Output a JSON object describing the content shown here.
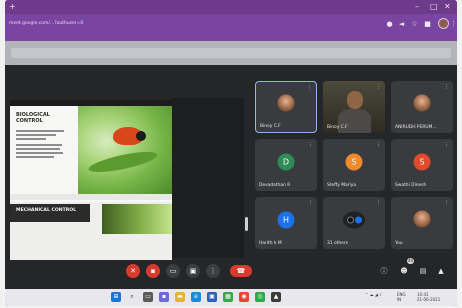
{
  "browser": {
    "url": "meet.google.com/...?authuser=0",
    "profile_icon": "user-avatar"
  },
  "slide": {
    "title": "BIOLOGICAL CONTROL",
    "bottom_title": "MECHANICAL CONTROL"
  },
  "participants": [
    {
      "name": "Binoy C.F",
      "avatar_type": "photo",
      "active": true
    },
    {
      "name": "Binoy C.F",
      "avatar_type": "camera",
      "active": false
    },
    {
      "name": "ANIRUDH PERUM...",
      "avatar_type": "photo",
      "active": false
    },
    {
      "name": "Devadathan R",
      "avatar_type": "initial",
      "initial": "D",
      "color": "#2e8b57",
      "active": false
    },
    {
      "name": "Steffy Mariya",
      "avatar_type": "initial",
      "initial": "S",
      "color": "#f08a2a",
      "active": false
    },
    {
      "name": "Swathi Dinesh",
      "avatar_type": "initial",
      "initial": "S",
      "color": "#e04a2c",
      "active": false
    },
    {
      "name": "Harith k M",
      "avatar_type": "initial",
      "initial": "H",
      "color": "#1a73e8",
      "active": false
    },
    {
      "name": "31 others",
      "avatar_type": "group",
      "active": false
    },
    {
      "name": "You",
      "avatar_type": "photo",
      "active": false
    }
  ],
  "controls": {
    "participants_count": "40",
    "icons": [
      "mic-off-icon",
      "camera-off-icon",
      "captions-icon",
      "present-icon",
      "more-icon",
      "hangup-icon",
      "info-icon",
      "people-icon",
      "chat-icon",
      "activities-icon"
    ]
  },
  "taskbar": {
    "lang": "ENG",
    "region": "IN",
    "time": "10:41",
    "date": "21-06-2021"
  }
}
